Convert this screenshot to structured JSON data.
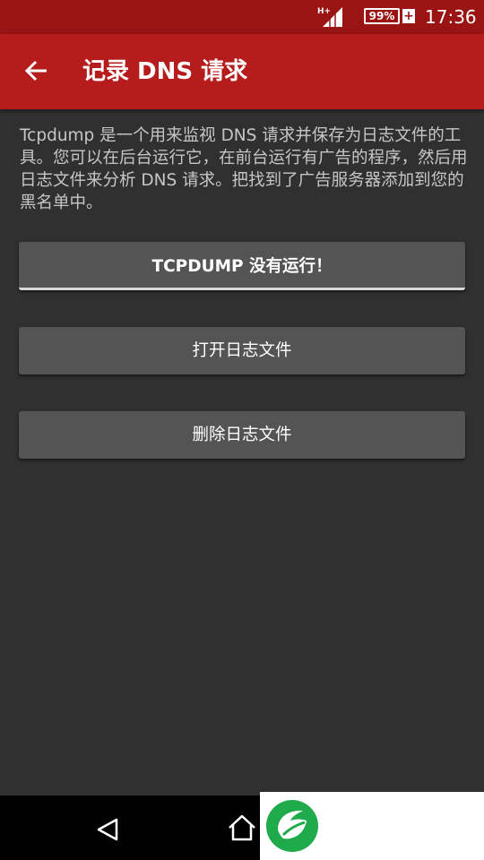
{
  "status_bar": {
    "network_label": "H+",
    "battery_text": "99%",
    "battery_charging_symbol": "+",
    "time": "17:36"
  },
  "app_bar": {
    "back_icon": "arrow-left-icon",
    "title": "记录 DNS 请求"
  },
  "main": {
    "description": "Tcpdump 是一个用来监视 DNS 请求并保存为日志文件的工具。您可以在后台运行它，在前台运行有广告的程序，然后用日志文件来分析 DNS 请求。把找到了广告服务器添加到您的黑名单中。",
    "buttons": {
      "status_label": "TCPDUMP 没有运行！",
      "open_log_label": "打开日志文件",
      "delete_log_label": "删除日志文件"
    }
  },
  "nav_bar": {
    "back_icon": "triangle-back-icon",
    "home_icon": "house-home-icon"
  },
  "colors": {
    "status_bar_bg": "#9a1414",
    "app_bar_bg": "#b71c1c",
    "content_bg": "#303030",
    "button_bg": "#545454",
    "logo_green": "#1faa4b"
  }
}
